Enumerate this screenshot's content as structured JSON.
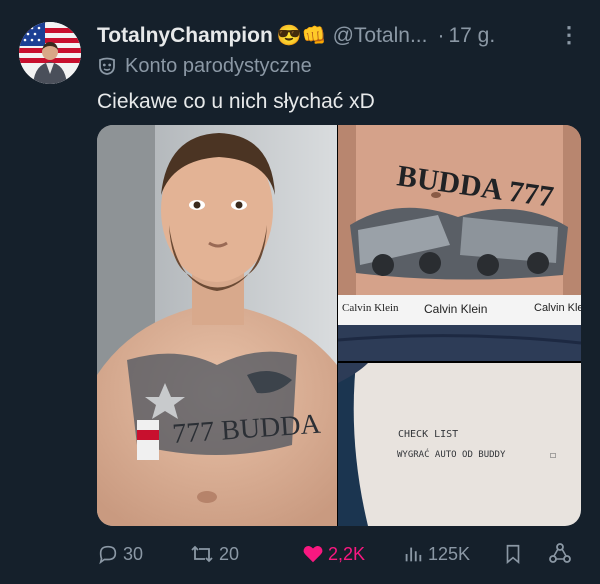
{
  "tweet": {
    "display_name": "TotalnyChampion",
    "name_emojis": "😎👊",
    "handle": "@Totaln...",
    "separator": "·",
    "time": "17 g.",
    "parody_label": "Konto parodystyczne",
    "text": "Ciekawe co u nich słychać xD"
  },
  "media": {
    "tattoo_text_1": "BUDDA 777",
    "underwear_brand": "Calvin Klein",
    "tattoo_chest_text": "777 BUDDA",
    "checklist_line_1": "CHECK LIST",
    "checklist_line_2": "WYGRAĆ AUTO OD BUDDY",
    "checkbox_mark": "☐"
  },
  "actions": {
    "replies": "30",
    "reposts": "20",
    "likes": "2,2K",
    "views": "125K"
  },
  "colors": {
    "background": "#15202b",
    "text_primary": "#e7e9ea",
    "text_secondary": "#8b98a5",
    "like_pink": "#f91880"
  }
}
